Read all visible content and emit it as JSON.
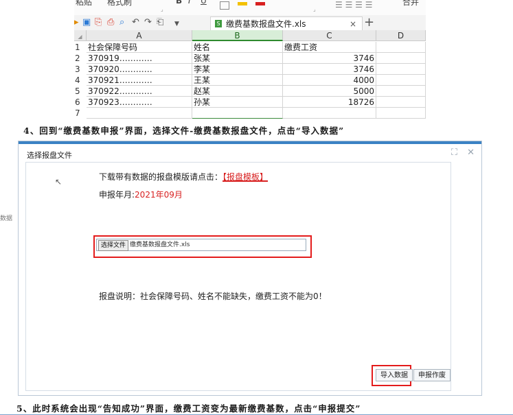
{
  "toolbar": {
    "ribbon_items": [
      "粘贴",
      "格式刷",
      "B",
      "I",
      "U",
      "合并"
    ],
    "file_tab_label": "缴费基数报盘文件.xls",
    "close_tab": "×",
    "new_tab": "+"
  },
  "spreadsheet": {
    "columns": [
      "A",
      "B",
      "C",
      "D"
    ],
    "rows": [
      {
        "num": "1",
        "a": "社会保障号码",
        "b": "姓名",
        "c": "缴费工资",
        "num_c": false
      },
      {
        "num": "2",
        "a": "370919…………",
        "b": "张某",
        "c": "3746",
        "num_c": true
      },
      {
        "num": "3",
        "a": "370920…………",
        "b": "李某",
        "c": "3746",
        "num_c": true
      },
      {
        "num": "4",
        "a": "370921…………",
        "b": "王某",
        "c": "4000",
        "num_c": true
      },
      {
        "num": "5",
        "a": "370922…………",
        "b": "赵某",
        "c": "5000",
        "num_c": true
      },
      {
        "num": "6",
        "a": "370923…………",
        "b": "孙某",
        "c": "18726",
        "num_c": true
      },
      {
        "num": "7",
        "a": "",
        "b": "",
        "c": "",
        "num_c": false
      }
    ]
  },
  "step4": "4、回到“缴费基数申报”界面，选择文件-缴费基数报盘文件，点击“导入数据”",
  "dialog": {
    "title": "选择报盘文件",
    "side_label": "数据",
    "download_text": "下载带有数据的报盘模版请点击：",
    "template_link": "【报盘模板】",
    "period_label": "申报年月:",
    "period_value": "2021年09月",
    "choose_file_button": "选择文件",
    "file_name": "缴费基数报盘文件.xls",
    "note": "报盘说明：社会保障号码、姓名不能缺失，缴费工资不能为0！",
    "import_button": "导入数据",
    "void_button": "申报作废"
  },
  "step5": "5、此时系统会出现“告知成功”界面，缴费工资变为最新缴费基数，点击“申报提交”",
  "colors": {
    "accent_blue": "#3b82c4",
    "highlight_red": "#e31b1b",
    "sheet_green": "#2f8a2f"
  }
}
